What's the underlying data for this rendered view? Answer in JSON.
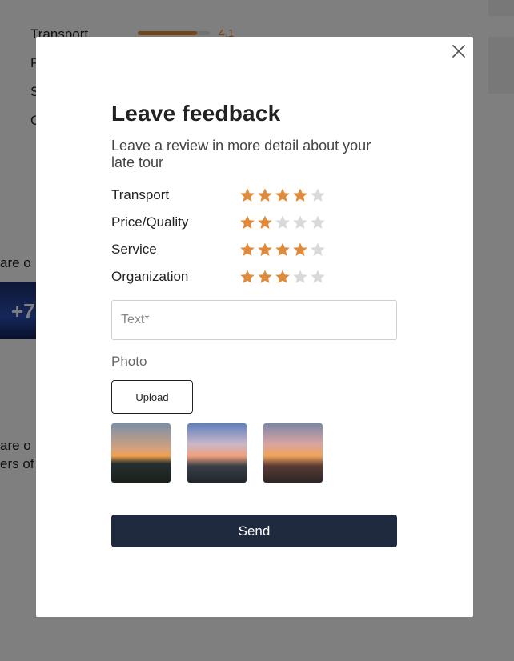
{
  "background": {
    "rows": [
      "Transport",
      "P",
      "S",
      "C"
    ],
    "score": "4.1",
    "score_fraction": 0.82,
    "text_lines": [
      "are o",
      "are o",
      "ers of"
    ],
    "photo_count": "+7"
  },
  "modal": {
    "title": "Leave feedback",
    "subtitle": "Leave a review in more detail about your late tour",
    "ratings": [
      {
        "label": "Transport",
        "value": 4,
        "max": 5
      },
      {
        "label": "Price/Quality",
        "value": 2,
        "max": 5
      },
      {
        "label": "Service",
        "value": 4,
        "max": 5
      },
      {
        "label": "Organization",
        "value": 3,
        "max": 5
      }
    ],
    "text_placeholder": "Text*",
    "photo_label": "Photo",
    "upload_label": "Upload",
    "photos": [
      "sunset-sea-photo",
      "sunset-city-photo",
      "sunset-parking-photo"
    ],
    "send_label": "Send",
    "close_icon": "close-icon"
  },
  "colors": {
    "star_active": "#e08a3c",
    "star_inactive": "#d9d9d9",
    "send_bg": "#1f2a3e"
  }
}
